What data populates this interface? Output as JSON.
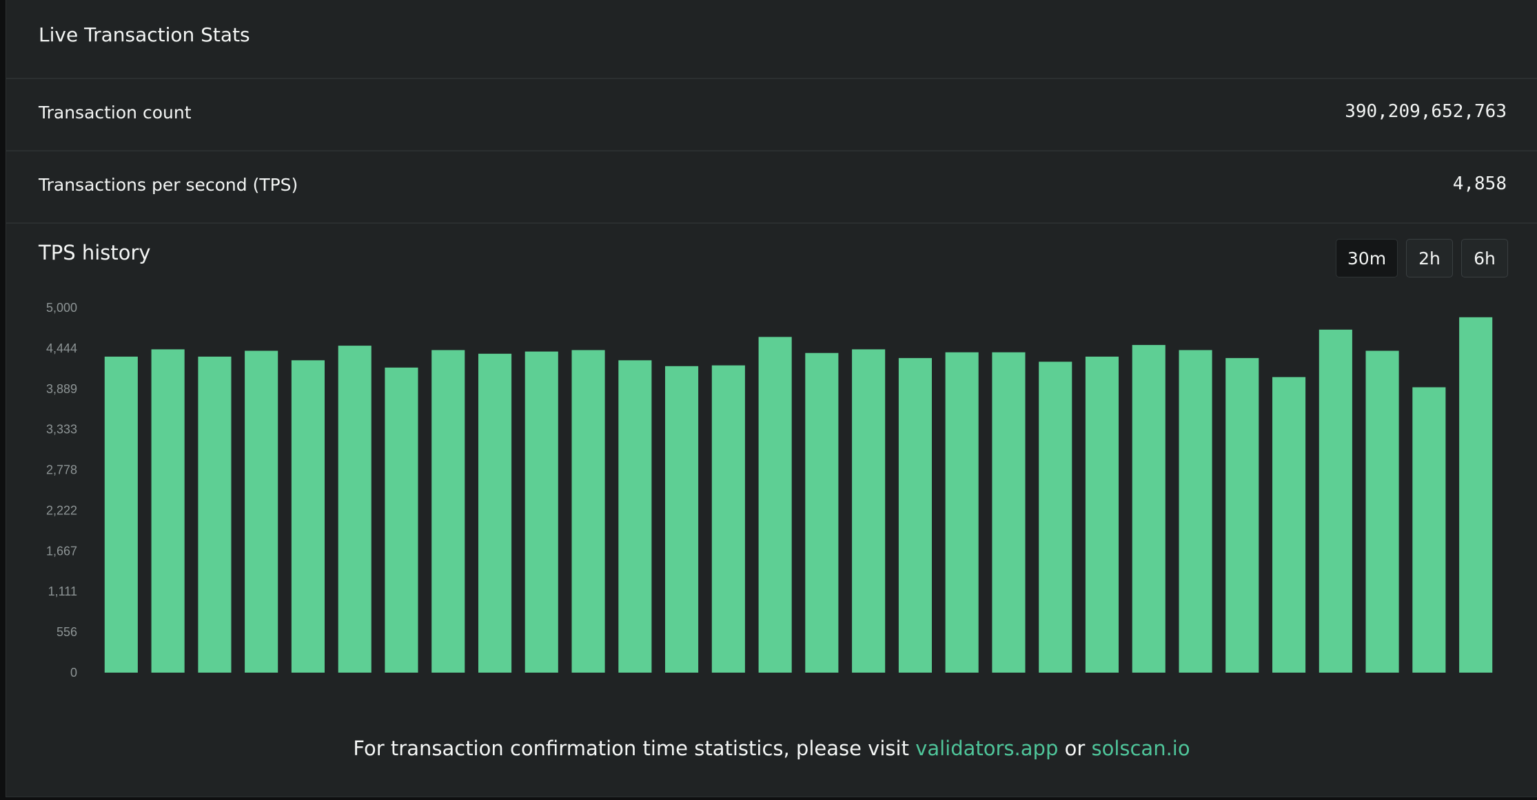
{
  "header": {
    "title": "Live Transaction Stats"
  },
  "stats": {
    "count_label": "Transaction count",
    "count_value": "390,209,652,763",
    "tps_label": "Transactions per second (TPS)",
    "tps_value": "4,858"
  },
  "history": {
    "title": "TPS history",
    "ranges": [
      "30m",
      "2h",
      "6h"
    ],
    "selected_range": "30m"
  },
  "colors": {
    "accent": "#5ecf94",
    "link": "#4fc59a",
    "background": "#202324"
  },
  "chart_data": {
    "type": "bar",
    "title": "",
    "xlabel": "",
    "ylabel": "",
    "ylim": [
      0,
      5000
    ],
    "y_ticks": [
      "5,000",
      "4,444",
      "3,889",
      "3,333",
      "2,778",
      "2,222",
      "1,667",
      "1,111",
      "556",
      "0"
    ],
    "grid": false,
    "series": [
      {
        "values": [
          4330,
          4430,
          4330,
          4410,
          4280,
          4480,
          4180,
          4420,
          4370,
          4400,
          4420,
          4280,
          4200,
          4210,
          4600,
          4380,
          4430,
          4310,
          4390,
          4390,
          4260,
          4330,
          4490,
          4420,
          4310,
          4050,
          4700,
          4410,
          3910,
          4870
        ]
      }
    ]
  },
  "footer": {
    "text": "For transaction confirmation time statistics, please visit",
    "link1": "validators.app",
    "conjunction": "or",
    "link2": "solscan.io"
  }
}
